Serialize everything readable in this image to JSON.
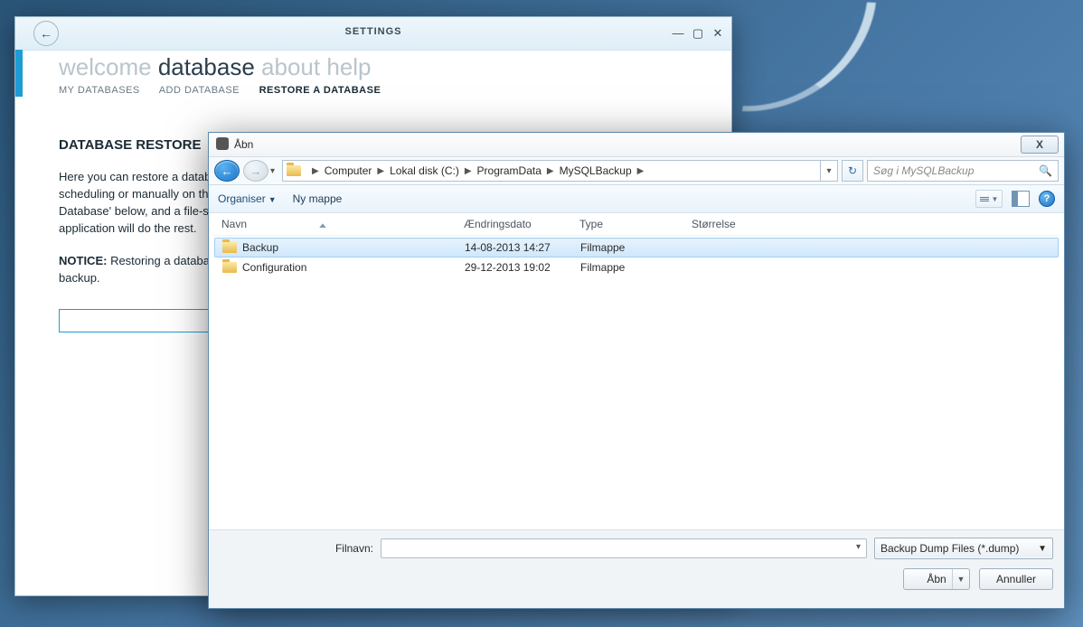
{
  "settings_window": {
    "title": "SETTINGS",
    "nav_top": [
      {
        "label": "welcome",
        "active": false
      },
      {
        "label": "database",
        "active": true
      },
      {
        "label": "about",
        "active": false
      },
      {
        "label": "help",
        "active": false
      }
    ],
    "nav_sub": [
      {
        "label": "MY DATABASES",
        "active": false
      },
      {
        "label": "ADD DATABASE",
        "active": false
      },
      {
        "label": "RESTORE A DATABASE",
        "active": true
      }
    ],
    "page_title": "DATABASE RESTORE",
    "para1": "Here you can restore a database from a backup file (.dump) previously created either automatically through scheduling or manually on this computer. The process of restoring a database is simple: click the 'Restore Database' below, and a file-select menu will appear, select the dump file you which to restore from, and the application will do the rest.",
    "notice_label": "NOTICE:",
    "notice_text": " Restoring a database will overwrite any current data in the database, with the data created in the backup."
  },
  "file_dialog": {
    "title": "Åbn",
    "close_label": "X",
    "breadcrumb": [
      "Computer",
      "Lokal disk (C:)",
      "ProgramData",
      "MySQLBackup"
    ],
    "search_placeholder": "Søg i MySQLBackup",
    "toolbar": {
      "organize": "Organiser",
      "new_folder": "Ny mappe"
    },
    "columns": {
      "name": "Navn",
      "date": "Ændringsdato",
      "type": "Type",
      "size": "Størrelse"
    },
    "rows": [
      {
        "name": "Backup",
        "date": "14-08-2013 14:27",
        "type": "Filmappe",
        "size": "",
        "selected": true
      },
      {
        "name": "Configuration",
        "date": "29-12-2013 19:02",
        "type": "Filmappe",
        "size": "",
        "selected": false
      }
    ],
    "filename_label": "Filnavn:",
    "filename_value": "",
    "filter_label": "Backup Dump Files (*.dump)",
    "open_label": "Åbn",
    "cancel_label": "Annuller"
  }
}
